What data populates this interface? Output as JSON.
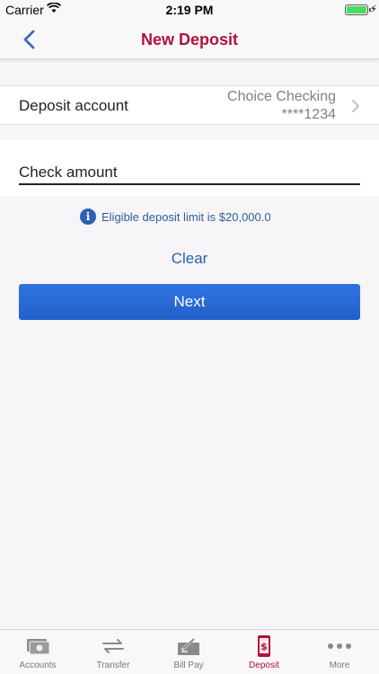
{
  "status_bar": {
    "carrier": "Carrier",
    "time": "2:19 PM"
  },
  "nav": {
    "title": "New Deposit",
    "accent_color": "#b0123b"
  },
  "deposit_account": {
    "label": "Deposit account",
    "account_name": "Choice Checking",
    "account_number": "****1234"
  },
  "check_amount": {
    "placeholder": "Check amount",
    "value": ""
  },
  "info": {
    "icon": "info-icon",
    "text": "Eligible deposit limit is $20,000.0"
  },
  "actions": {
    "clear_label": "Clear",
    "next_label": "Next",
    "button_color": "#2a6bd8"
  },
  "tabs": [
    {
      "label": "Accounts",
      "icon": "accounts-icon",
      "active": false
    },
    {
      "label": "Transfer",
      "icon": "transfer-icon",
      "active": false
    },
    {
      "label": "Bill Pay",
      "icon": "bill-pay-icon",
      "active": false
    },
    {
      "label": "Deposit",
      "icon": "deposit-icon",
      "active": true
    },
    {
      "label": "More",
      "icon": "more-icon",
      "active": false
    }
  ]
}
